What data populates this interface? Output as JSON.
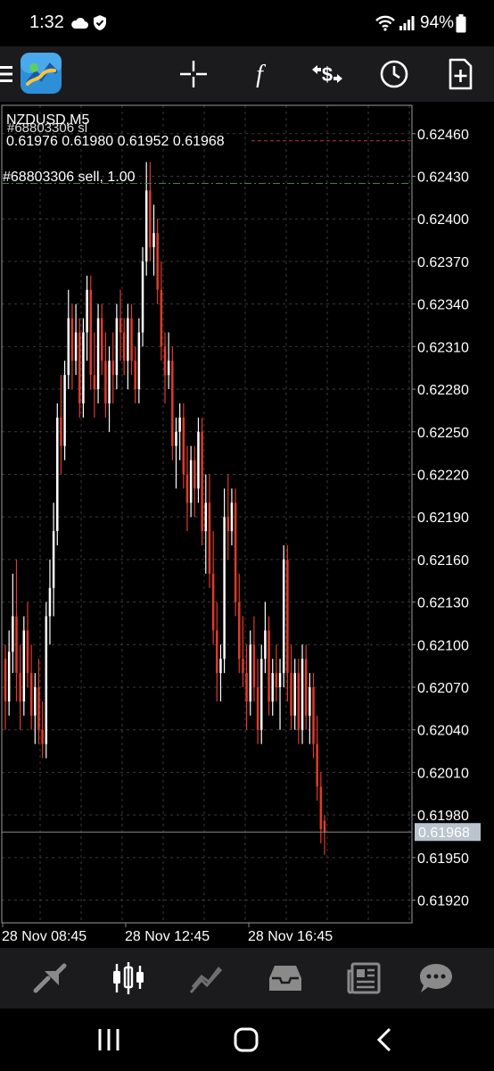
{
  "status_bar": {
    "time": "1:32",
    "battery": "94%",
    "icons": [
      "cloud-icon",
      "shield-check-icon",
      "wifi-icon",
      "signal-icon",
      "battery-icon"
    ]
  },
  "toolbar": {
    "icons": [
      "menu-icon",
      "metatrader-logo-icon",
      "crosshair-icon",
      "indicator-f-icon",
      "trade-dollar-icon",
      "clock-icon",
      "new-order-icon"
    ]
  },
  "chart": {
    "symbol_timeframe": "NZDUSD,M5",
    "ohlc_line": "0.61976 0.61980 0.61952 0.61968",
    "sl_label": "#68803306 sl",
    "position_label": "#68803306 sell, 1.00",
    "current_price": "0.61968",
    "colors": {
      "bull": "#ffffff",
      "bear": "#e03a2a",
      "grid": "#3a3a3a",
      "sl_line": "#b83a3a",
      "position_line": "#4f7a4f",
      "bid_line": "#8a8a8a",
      "price_tag_bg": "#b9c4cf"
    }
  },
  "chart_data": {
    "type": "candlestick",
    "symbol": "NZDUSD",
    "timeframe": "M5",
    "y_ticks": [
      0.6246,
      0.6243,
      0.624,
      0.6237,
      0.6234,
      0.6231,
      0.6228,
      0.6225,
      0.6222,
      0.6219,
      0.6216,
      0.6213,
      0.621,
      0.6207,
      0.6204,
      0.6201,
      0.6198,
      0.6195,
      0.6192
    ],
    "y_tick_labels": [
      "0.62460",
      "0.62430",
      "0.62400",
      "0.62370",
      "0.62340",
      "0.62310",
      "0.62280",
      "0.62250",
      "0.62220",
      "0.62190",
      "0.62160",
      "0.62130",
      "0.62100",
      "0.62070",
      "0.62040",
      "0.62010",
      "0.61980",
      "0.61950",
      "0.61920"
    ],
    "x_labels": [
      "28 Nov 08:45",
      "28 Nov 12:45",
      "28 Nov 16:45"
    ],
    "ylim": [
      0.61904,
      0.6248
    ],
    "levels": {
      "stop_loss": 0.62455,
      "sell_entry": 0.62425,
      "bid": 0.61968
    },
    "grid": true,
    "candles": [
      [
        0.6209,
        0.621,
        0.6204,
        0.6206
      ],
      [
        0.6206,
        0.6211,
        0.6205,
        0.62095
      ],
      [
        0.62095,
        0.6215,
        0.6208,
        0.6212
      ],
      [
        0.6212,
        0.6216,
        0.6206,
        0.6208
      ],
      [
        0.6208,
        0.621,
        0.6204,
        0.6206
      ],
      [
        0.6206,
        0.6212,
        0.6205,
        0.6211
      ],
      [
        0.6211,
        0.6213,
        0.6207,
        0.6208
      ],
      [
        0.6208,
        0.621,
        0.6204,
        0.6205
      ],
      [
        0.6205,
        0.6208,
        0.6203,
        0.6207
      ],
      [
        0.6207,
        0.6209,
        0.6203,
        0.6204
      ],
      [
        0.6204,
        0.6206,
        0.6202,
        0.6203
      ],
      [
        0.6203,
        0.6213,
        0.6202,
        0.6212
      ],
      [
        0.6212,
        0.6216,
        0.621,
        0.6214
      ],
      [
        0.6214,
        0.622,
        0.6212,
        0.6218
      ],
      [
        0.6218,
        0.6227,
        0.6217,
        0.6226
      ],
      [
        0.6226,
        0.6229,
        0.6222,
        0.6224
      ],
      [
        0.6224,
        0.623,
        0.6223,
        0.6229
      ],
      [
        0.6229,
        0.6235,
        0.6228,
        0.6233
      ],
      [
        0.6233,
        0.6234,
        0.6228,
        0.623
      ],
      [
        0.623,
        0.6234,
        0.6229,
        0.6232
      ],
      [
        0.6232,
        0.6233,
        0.6226,
        0.6227
      ],
      [
        0.6227,
        0.6233,
        0.6226,
        0.6232
      ],
      [
        0.6232,
        0.6236,
        0.623,
        0.6235
      ],
      [
        0.6235,
        0.6236,
        0.6228,
        0.6229
      ],
      [
        0.6229,
        0.6232,
        0.6226,
        0.6228
      ],
      [
        0.6228,
        0.6234,
        0.6227,
        0.6233
      ],
      [
        0.6233,
        0.6234,
        0.6229,
        0.623
      ],
      [
        0.623,
        0.6232,
        0.6226,
        0.6227
      ],
      [
        0.6227,
        0.6231,
        0.6225,
        0.623
      ],
      [
        0.623,
        0.6232,
        0.6227,
        0.6229
      ],
      [
        0.6229,
        0.6234,
        0.6228,
        0.6233
      ],
      [
        0.6233,
        0.6235,
        0.623,
        0.6232
      ],
      [
        0.6232,
        0.6233,
        0.6229,
        0.623
      ],
      [
        0.623,
        0.6234,
        0.6228,
        0.6233
      ],
      [
        0.6233,
        0.6234,
        0.6229,
        0.623
      ],
      [
        0.623,
        0.6231,
        0.6227,
        0.6228
      ],
      [
        0.6228,
        0.6233,
        0.6227,
        0.6232
      ],
      [
        0.6232,
        0.6238,
        0.6231,
        0.6237
      ],
      [
        0.6237,
        0.6244,
        0.6236,
        0.6242
      ],
      [
        0.6242,
        0.6244,
        0.6237,
        0.6238
      ],
      [
        0.6238,
        0.6241,
        0.6236,
        0.6239
      ],
      [
        0.6239,
        0.624,
        0.6234,
        0.6235
      ],
      [
        0.6235,
        0.6237,
        0.623,
        0.6231
      ],
      [
        0.6231,
        0.6232,
        0.6227,
        0.6229
      ],
      [
        0.6229,
        0.6232,
        0.6228,
        0.623
      ],
      [
        0.623,
        0.6231,
        0.6223,
        0.6224
      ],
      [
        0.6224,
        0.6226,
        0.6221,
        0.6225
      ],
      [
        0.6225,
        0.6227,
        0.6223,
        0.6226
      ],
      [
        0.6226,
        0.6227,
        0.6221,
        0.6222
      ],
      [
        0.6222,
        0.6224,
        0.6218,
        0.622
      ],
      [
        0.622,
        0.6224,
        0.6219,
        0.6223
      ],
      [
        0.6223,
        0.6224,
        0.6219,
        0.6221
      ],
      [
        0.6221,
        0.6226,
        0.622,
        0.6225
      ],
      [
        0.6225,
        0.6226,
        0.6217,
        0.6218
      ],
      [
        0.6218,
        0.6222,
        0.6215,
        0.622
      ],
      [
        0.622,
        0.6222,
        0.6214,
        0.6215
      ],
      [
        0.6215,
        0.6218,
        0.621,
        0.6211
      ],
      [
        0.6211,
        0.6213,
        0.6206,
        0.6208
      ],
      [
        0.6208,
        0.621,
        0.6206,
        0.6209
      ],
      [
        0.6209,
        0.6221,
        0.6208,
        0.6219
      ],
      [
        0.6219,
        0.6222,
        0.6216,
        0.6218
      ],
      [
        0.6218,
        0.6221,
        0.6217,
        0.622
      ],
      [
        0.622,
        0.6221,
        0.6212,
        0.6213
      ],
      [
        0.6213,
        0.6215,
        0.6208,
        0.6209
      ],
      [
        0.6209,
        0.6212,
        0.6207,
        0.6208
      ],
      [
        0.6208,
        0.621,
        0.6204,
        0.6206
      ],
      [
        0.6206,
        0.6211,
        0.6205,
        0.621
      ],
      [
        0.621,
        0.6212,
        0.6206,
        0.6207
      ],
      [
        0.6207,
        0.6209,
        0.6203,
        0.6204
      ],
      [
        0.6204,
        0.621,
        0.6203,
        0.6209
      ],
      [
        0.6209,
        0.6213,
        0.6208,
        0.6211
      ],
      [
        0.6211,
        0.6212,
        0.6205,
        0.6206
      ],
      [
        0.6206,
        0.6209,
        0.6205,
        0.6208
      ],
      [
        0.6208,
        0.621,
        0.6206,
        0.6207
      ],
      [
        0.6207,
        0.6209,
        0.6204,
        0.6208
      ],
      [
        0.6208,
        0.6217,
        0.6207,
        0.6216
      ],
      [
        0.6216,
        0.6217,
        0.6206,
        0.6208
      ],
      [
        0.6208,
        0.621,
        0.6204,
        0.6205
      ],
      [
        0.6205,
        0.6209,
        0.6204,
        0.6208
      ],
      [
        0.6208,
        0.6209,
        0.6203,
        0.6204
      ],
      [
        0.6204,
        0.621,
        0.6203,
        0.6209
      ],
      [
        0.6209,
        0.621,
        0.6204,
        0.6205
      ],
      [
        0.6205,
        0.6208,
        0.6203,
        0.6207
      ],
      [
        0.6207,
        0.6208,
        0.6202,
        0.6203
      ],
      [
        0.6203,
        0.6205,
        0.6199,
        0.62
      ],
      [
        0.62,
        0.6201,
        0.6196,
        0.6197
      ],
      [
        0.61976,
        0.6198,
        0.61952,
        0.61968
      ]
    ]
  },
  "bottom_nav": {
    "items": [
      "quotes-icon",
      "chart-icon",
      "trade-icon",
      "history-icon",
      "news-icon",
      "chat-icon"
    ],
    "active_index": 1
  },
  "system_nav": {
    "items": [
      "recent-apps-icon",
      "home-icon",
      "back-icon"
    ]
  }
}
